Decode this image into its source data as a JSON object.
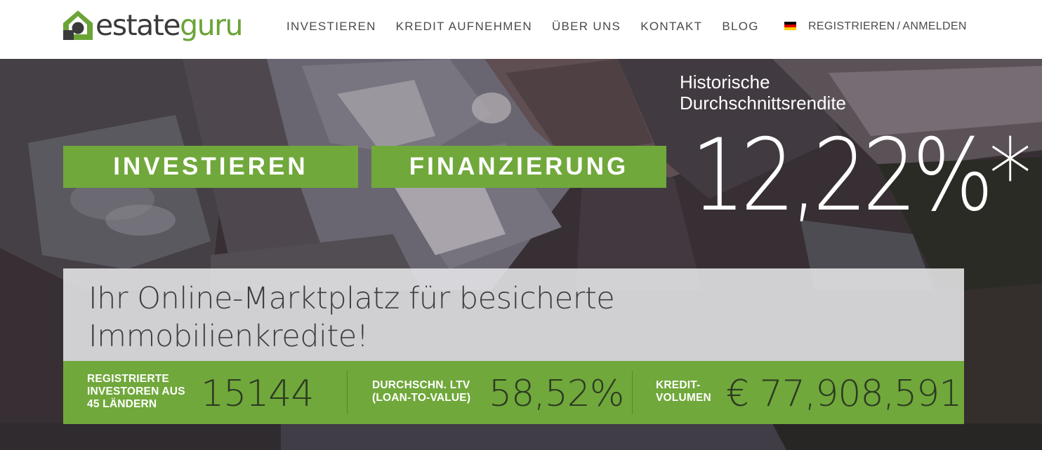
{
  "brand": {
    "name_part1": "estate",
    "name_part2": "guru",
    "colors": {
      "green": "#70a83b",
      "dark": "#3a3a3a"
    }
  },
  "nav": {
    "items": [
      {
        "label": "INVESTIEREN"
      },
      {
        "label": "KREDIT AUFNEHMEN"
      },
      {
        "label": "ÜBER UNS"
      },
      {
        "label": "KONTAKT"
      },
      {
        "label": "BLOG"
      }
    ],
    "language_icon": "germany-flag-icon",
    "register": "REGISTRIEREN",
    "separator": "/",
    "login": "ANMELDEN"
  },
  "hero": {
    "rate_heading_line1": "Historische",
    "rate_heading_line2": "Durchschnittsrendite",
    "rate_value": "12,22%*",
    "cta_invest": "INVESTIEREN",
    "cta_finance": "FINANZIERUNG",
    "tagline_line1": "Ihr Online-Marktplatz für besicherte",
    "tagline_line2": "Immobilienkredite!"
  },
  "stats": [
    {
      "label_lines": [
        "REGISTRIERTE",
        "INVESTOREN AUS",
        "45 LÄNDERN"
      ],
      "value": "15144"
    },
    {
      "label_lines": [
        "DURCHSCHN. LTV",
        "(LOAN-TO-VALUE)"
      ],
      "value": "58,52%"
    },
    {
      "label_lines": [
        "KREDIT-",
        "VOLUMEN"
      ],
      "value": "€ 77,908,591"
    }
  ]
}
